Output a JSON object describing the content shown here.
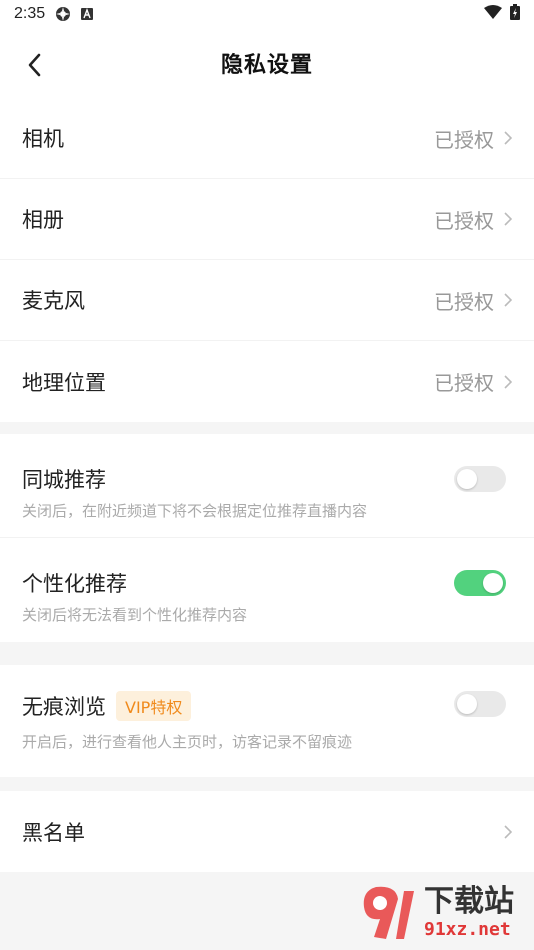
{
  "status_bar": {
    "time": "2:35",
    "icons": [
      "settings-gear-icon",
      "a-badge-icon"
    ],
    "right_icons": [
      "wifi-icon",
      "battery-charging-icon"
    ]
  },
  "header": {
    "title": "隐私设置",
    "back_icon": "chevron-left-icon"
  },
  "permissions": [
    {
      "label": "相机",
      "value": "已授权"
    },
    {
      "label": "相册",
      "value": "已授权"
    },
    {
      "label": "麦克风",
      "value": "已授权"
    },
    {
      "label": "地理位置",
      "value": "已授权"
    }
  ],
  "toggles": [
    {
      "label": "同城推荐",
      "desc": "关闭后，在附近频道下将不会根据定位推荐直播内容",
      "on": false
    },
    {
      "label": "个性化推荐",
      "desc": "关闭后将无法看到个性化推荐内容",
      "on": true
    }
  ],
  "incognito": {
    "label": "无痕浏览",
    "badge": "VIP特权",
    "desc": "开启后，进行查看他人主页时，访客记录不留痕迹",
    "on": false
  },
  "blacklist": {
    "label": "黑名单"
  },
  "watermark": {
    "cn": "下载站",
    "url": "91xz.net"
  },
  "colors": {
    "toggle_on": "#52d27e",
    "toggle_off": "#e9e9e9",
    "badge_bg": "#fdf0dc",
    "badge_text": "#f08a1c"
  }
}
